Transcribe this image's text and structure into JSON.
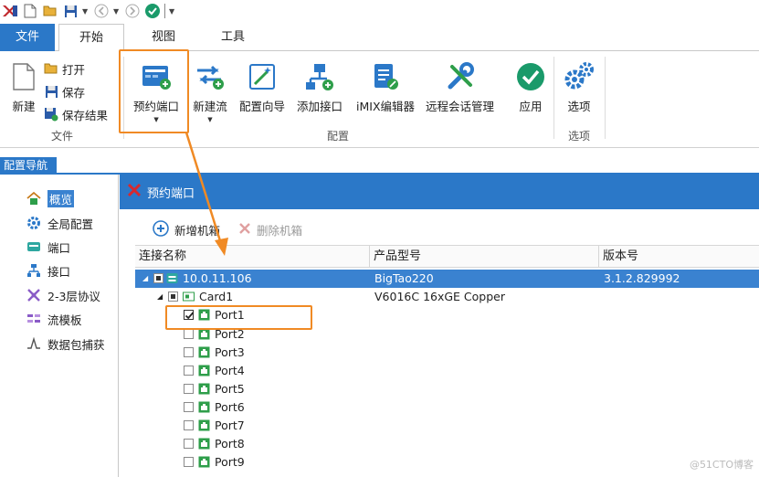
{
  "ribbon": {
    "tabs": [
      "文件",
      "开始",
      "视图",
      "工具"
    ],
    "file_group": {
      "new_label": "新建",
      "open_label": "打开",
      "save_label": "保存",
      "save_result_label": "保存结果",
      "group_label": "文件"
    },
    "config_group": {
      "buttons": [
        "预约端口",
        "新建流",
        "配置向导",
        "添加接口",
        "iMIX编辑器",
        "远程会话管理",
        "应用"
      ],
      "group_label": "配置"
    },
    "options_group": {
      "button": "选项",
      "group_label": "选项"
    }
  },
  "nav": {
    "header": "配置导航",
    "items": [
      "概览",
      "全局配置",
      "端口",
      "接口",
      "2-3层协议",
      "流模板",
      "数据包捕获"
    ],
    "selected": "概览"
  },
  "panel": {
    "title": "预约端口",
    "add_chassis": "新增机箱",
    "delete_chassis": "删除机箱",
    "columns": [
      "连接名称",
      "产品型号",
      "版本号"
    ],
    "chassis": {
      "name": "10.0.11.106",
      "model": "BigTao220",
      "version": "3.1.2.829992"
    },
    "card": {
      "name": "Card1",
      "model": "V6016C 16xGE Copper"
    },
    "ports": [
      "Port1",
      "Port2",
      "Port3",
      "Port4",
      "Port5",
      "Port6",
      "Port7",
      "Port8",
      "Port9"
    ]
  },
  "colors": {
    "accent": "#2b78c8",
    "highlight": "#f08a24",
    "port_green": "#2e9e4a"
  },
  "watermark": "@51CTO博客"
}
